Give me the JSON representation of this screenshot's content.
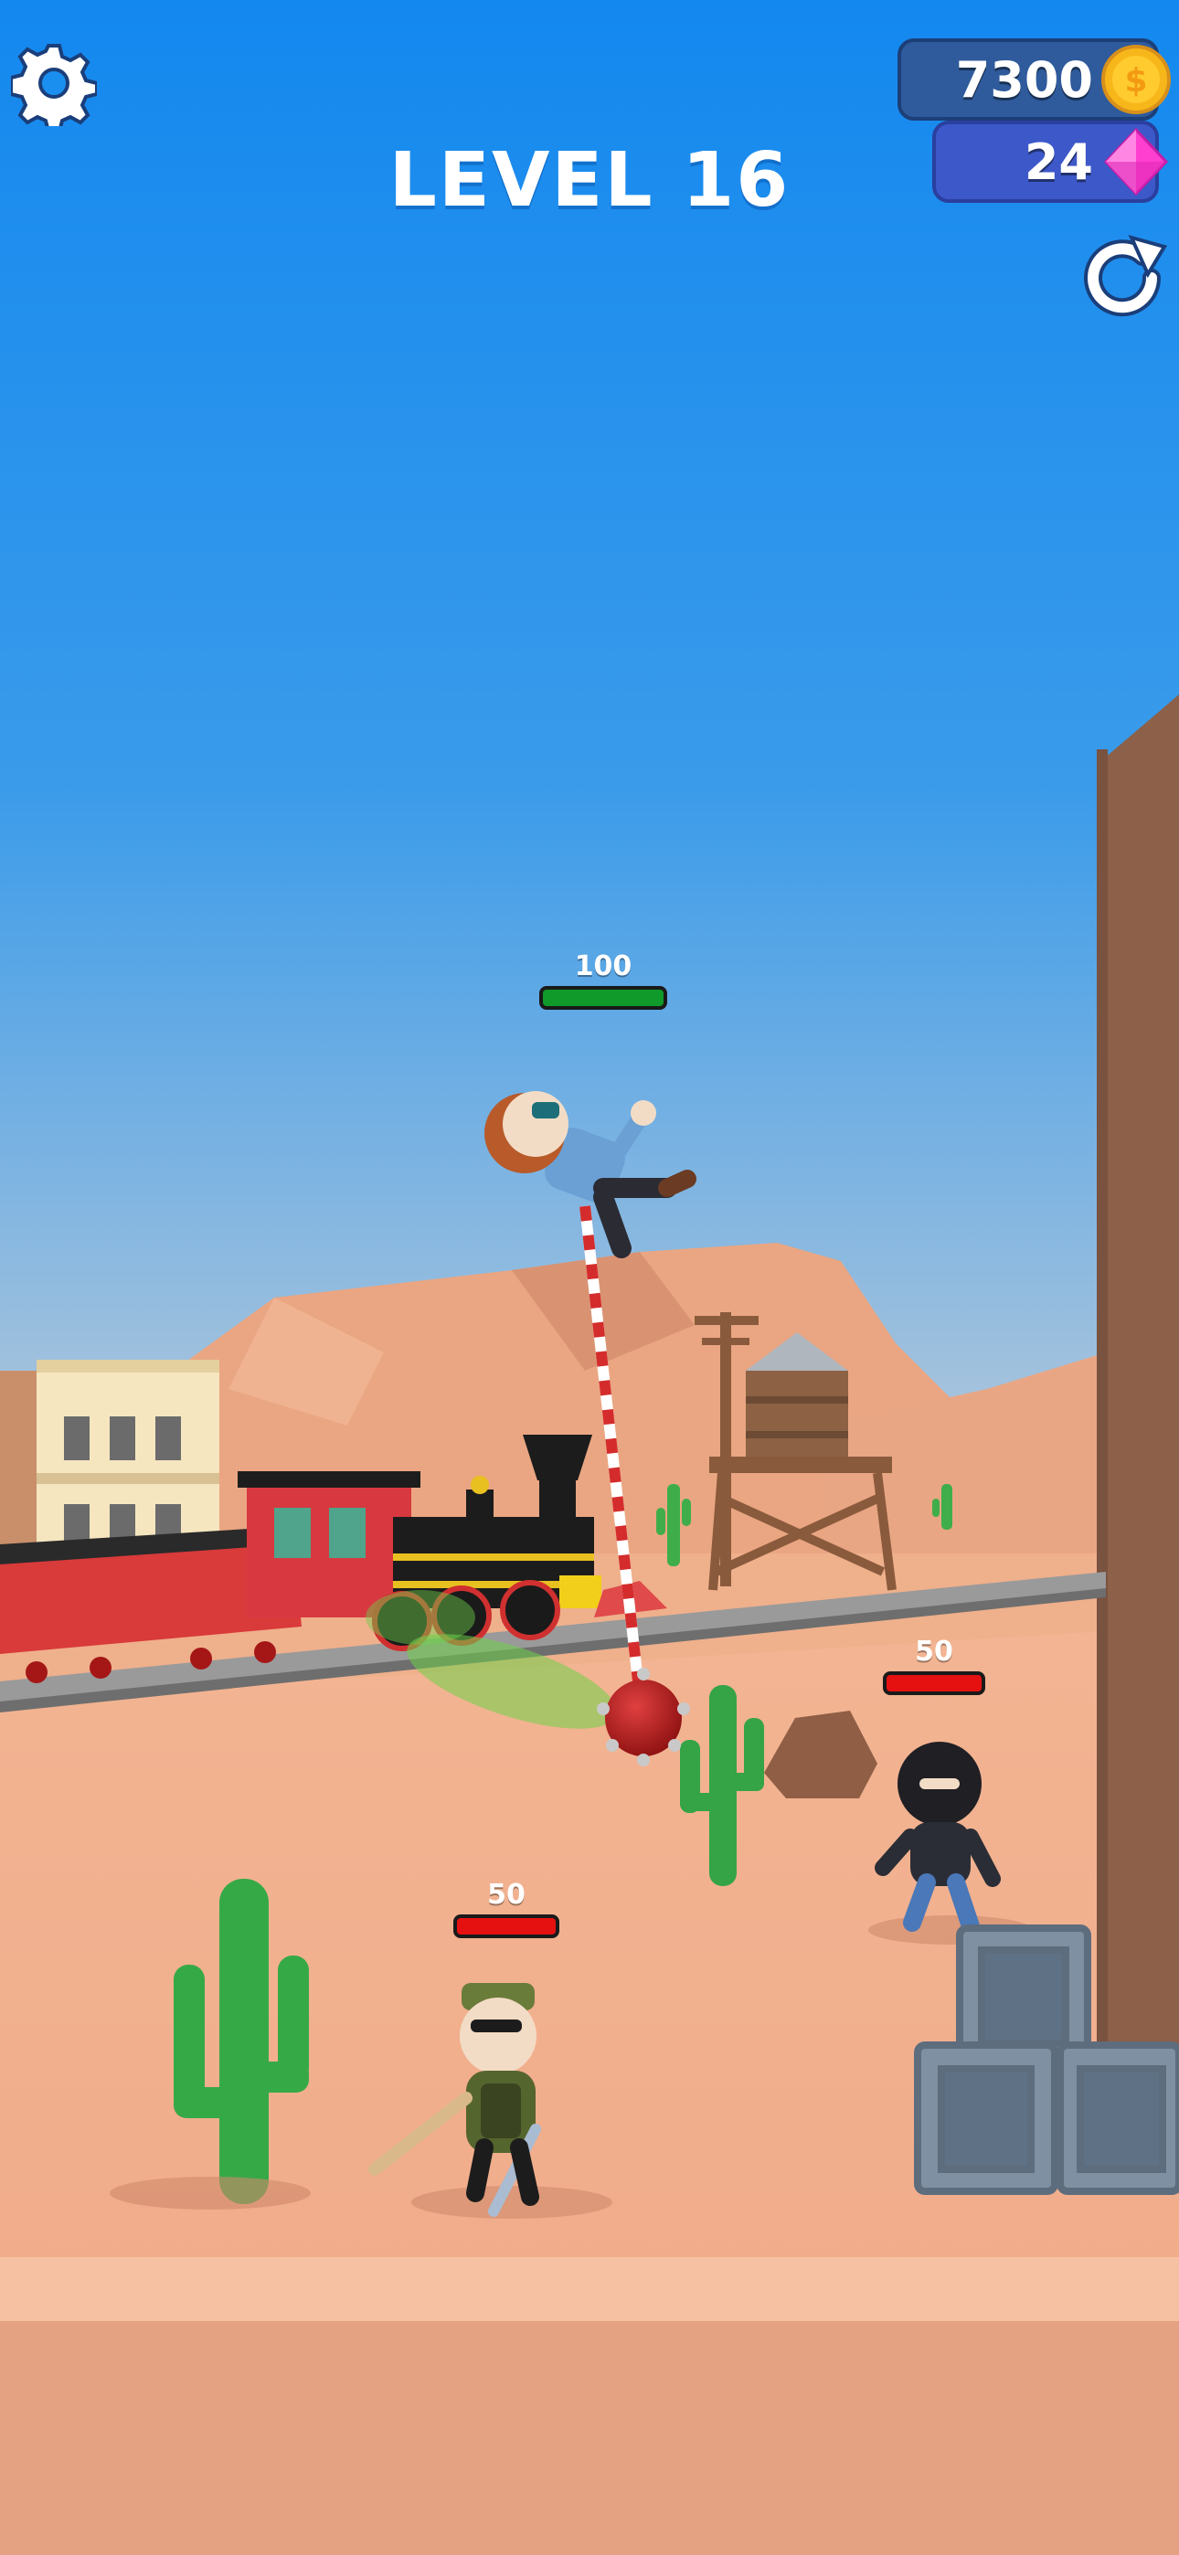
{
  "hud": {
    "level_label": "LEVEL 16",
    "coins": "7300",
    "gems": "24"
  },
  "characters": {
    "player": {
      "name": "player",
      "health": "100",
      "health_fraction": 1.0,
      "bar_color": "#0f9a2a"
    },
    "enemy_masked": {
      "name": "masked-thug",
      "health": "50",
      "health_fraction": 1.0,
      "bar_color": "#e51111"
    },
    "enemy_soldier": {
      "name": "soldier-thug",
      "health": "50",
      "health_fraction": 1.0,
      "bar_color": "#e51111"
    }
  },
  "icons": {
    "settings": "gear-icon",
    "coin": "coin-icon",
    "gem": "gem-icon",
    "restart": "restart-icon"
  },
  "colors": {
    "sky_top": "#1a8ff0",
    "sky_bottom": "#8fb6dc",
    "sand": "#f0b08e",
    "cliff": "#8a5f47"
  }
}
